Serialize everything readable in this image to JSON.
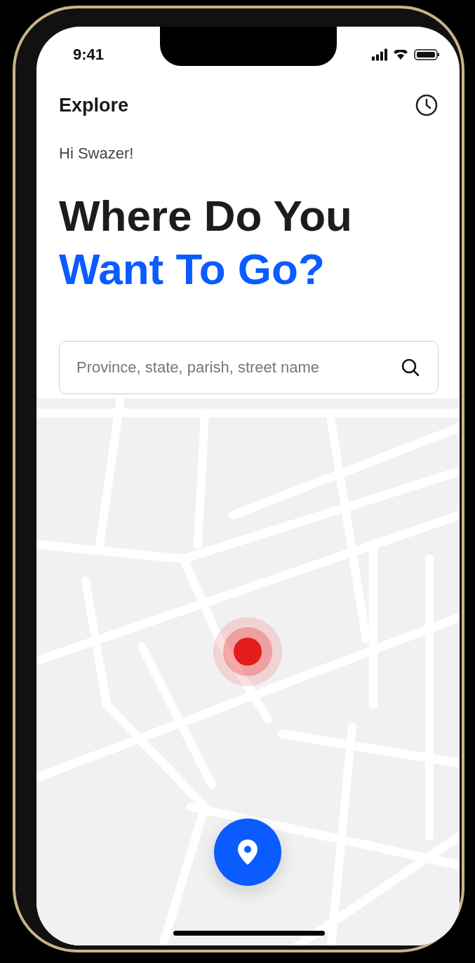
{
  "status_bar": {
    "time": "9:41"
  },
  "header": {
    "title": "Explore"
  },
  "greeting": "Hi Swazer!",
  "headline": {
    "line_1": "Where Do You",
    "line_2": "Want To Go?"
  },
  "search": {
    "placeholder": "Province, state, parish, street name"
  }
}
